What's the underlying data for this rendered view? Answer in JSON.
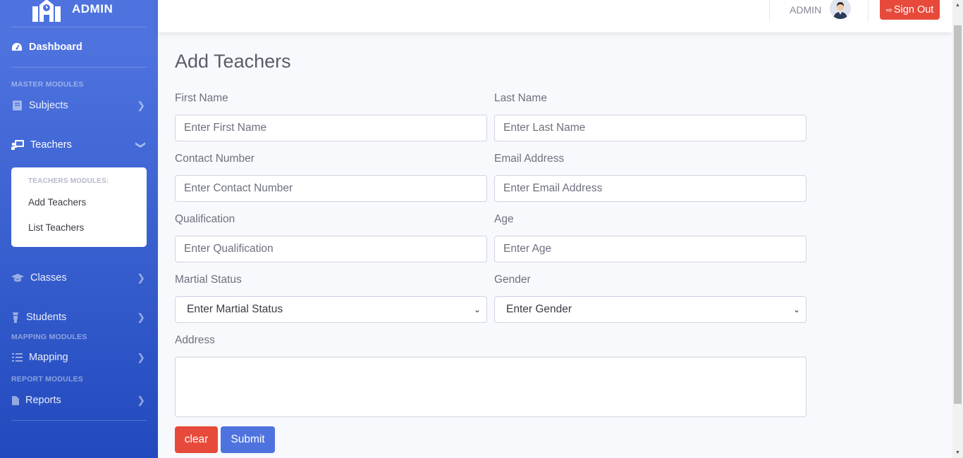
{
  "sidebar": {
    "brand": "ADMIN",
    "dashboard": "Dashboard",
    "heading_master": "MASTER MODULES",
    "subjects": "Subjects",
    "teachers": "Teachers",
    "teachers_modules_heading": "TEACHERS MODULES:",
    "add_teachers": "Add Teachers",
    "list_teachers": "List Teachers",
    "classes": "Classes",
    "students": "Students",
    "heading_mapping": "MAPPING MODULES",
    "mapping": "Mapping",
    "heading_report": "REPORT MODULES",
    "reports": "Reports"
  },
  "topbar": {
    "user_name": "ADMIN",
    "signout_label": "Sign Out"
  },
  "form": {
    "title": "Add Teachers",
    "first_name_label": "First Name",
    "first_name_placeholder": "Enter First Name",
    "last_name_label": "Last Name",
    "last_name_placeholder": "Enter Last Name",
    "contact_label": "Contact Number",
    "contact_placeholder": "Enter Contact Number",
    "email_label": "Email Address",
    "email_placeholder": "Enter Email Address",
    "qualification_label": "Qualification",
    "qualification_placeholder": "Enter Qualification",
    "age_label": "Age",
    "age_placeholder": "Enter Age",
    "martial_label": "Martial Status",
    "martial_selected": "Enter Martial Status",
    "gender_label": "Gender",
    "gender_selected": "Enter Gender",
    "address_label": "Address",
    "clear_label": "clear",
    "submit_label": "Submit"
  },
  "colors": {
    "primary": "#4e73df",
    "danger": "#e74a3b"
  }
}
